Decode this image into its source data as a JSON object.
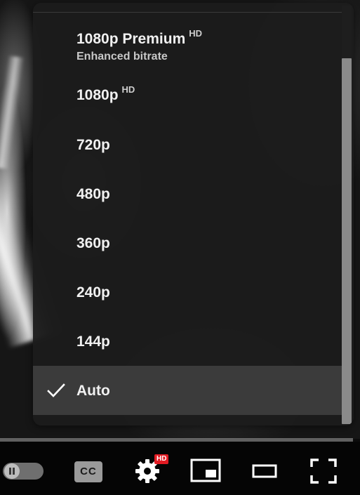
{
  "quality_menu": {
    "items": [
      {
        "label": "1080p Premium",
        "badge": "HD",
        "sublabel": "Enhanced bitrate",
        "selected": false
      },
      {
        "label": "1080p",
        "badge": "HD",
        "selected": false
      },
      {
        "label": "720p",
        "selected": false
      },
      {
        "label": "480p",
        "selected": false
      },
      {
        "label": "360p",
        "selected": false
      },
      {
        "label": "240p",
        "selected": false
      },
      {
        "label": "144p",
        "selected": false
      },
      {
        "label": "Auto",
        "selected": true,
        "icon": "checkmark-icon"
      }
    ]
  },
  "controls": {
    "captions_label": "CC",
    "settings_badge": "HD",
    "icons": [
      "pause-icon",
      "captions-icon",
      "settings-gear-icon",
      "miniplayer-icon",
      "theater-mode-icon",
      "fullscreen-icon"
    ]
  },
  "colors": {
    "menu_background": "#1c1c1c",
    "selected_row": "#3b3b3b",
    "hd_badge": "#e21b23"
  }
}
